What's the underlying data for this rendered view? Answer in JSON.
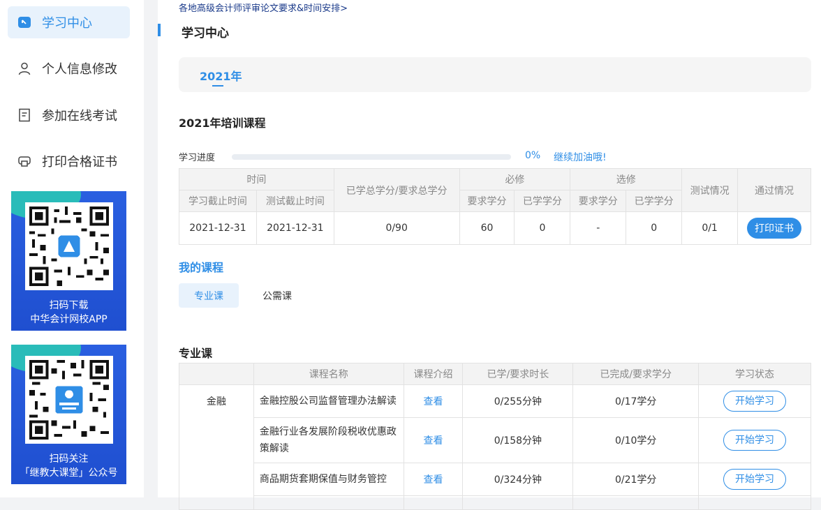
{
  "sidebar": {
    "items": [
      {
        "label": "学习中心",
        "icon": "book-icon"
      },
      {
        "label": "个人信息修改",
        "icon": "user-icon"
      },
      {
        "label": "参加在线考试",
        "icon": "document-icon"
      },
      {
        "label": "打印合格证书",
        "icon": "printer-icon"
      }
    ],
    "promo1": {
      "line1": "扫码下载",
      "line2": "中华会计网校APP"
    },
    "promo2": {
      "line1": "扫码关注",
      "line2": "「继教大课堂」公众号"
    }
  },
  "main": {
    "top_link": "各地高级会计师评审论文要求&时间安排>",
    "title": "学习中心",
    "year_tab": "2021年",
    "training_title": "2021年培训课程",
    "progress": {
      "label": "学习进度",
      "value": 0,
      "percent_text": "0%",
      "cheer": "继续加油哦!"
    },
    "summary_table": {
      "h_time": "时间",
      "h_credit": "已学总学分/要求总学分",
      "h_required": "必修",
      "h_elective": "选修",
      "h_test": "测试情况",
      "h_pass": "通过情况",
      "h_study_deadline": "学习截止时间",
      "h_test_deadline": "测试截止时间",
      "h_req_credit": "要求学分",
      "h_got_credit": "已学学分",
      "h_elec_req": "要求学分",
      "h_elec_got": "已学学分",
      "row": {
        "study_deadline": "2021-12-31",
        "test_deadline": "2021-12-31",
        "credit": "0/90",
        "req_required": "60",
        "req_got": "0",
        "elec_required": "-",
        "elec_got": "0",
        "test": "0/1",
        "print_btn": "打印证书"
      }
    },
    "my_courses": "我的课程",
    "course_tabs": [
      "专业课",
      "公需课"
    ],
    "course_section_title": "专业课",
    "course_table": {
      "headers": [
        "课程名称",
        "课程介绍",
        "已学/要求时长",
        "已完成/要求学分",
        "学习状态"
      ],
      "category": "金融",
      "rows": [
        {
          "name": "金融控股公司监督管理办法解读",
          "intro": "查看",
          "time": "0/255分钟",
          "credit": "0/17学分",
          "status": "开始学习"
        },
        {
          "name": "金融行业各发展阶段税收优惠政策解读",
          "intro": "查看",
          "time": "0/158分钟",
          "credit": "0/10学分",
          "status": "开始学习"
        },
        {
          "name": "商品期货套期保值与财务管控",
          "intro": "查看",
          "time": "0/324分钟",
          "credit": "0/21学分",
          "status": "开始学习"
        }
      ]
    }
  },
  "colors": {
    "accent": "#2f8ee6",
    "promo_bg": "#2a5fe0",
    "promo_swoosh": "#29c7b5"
  }
}
